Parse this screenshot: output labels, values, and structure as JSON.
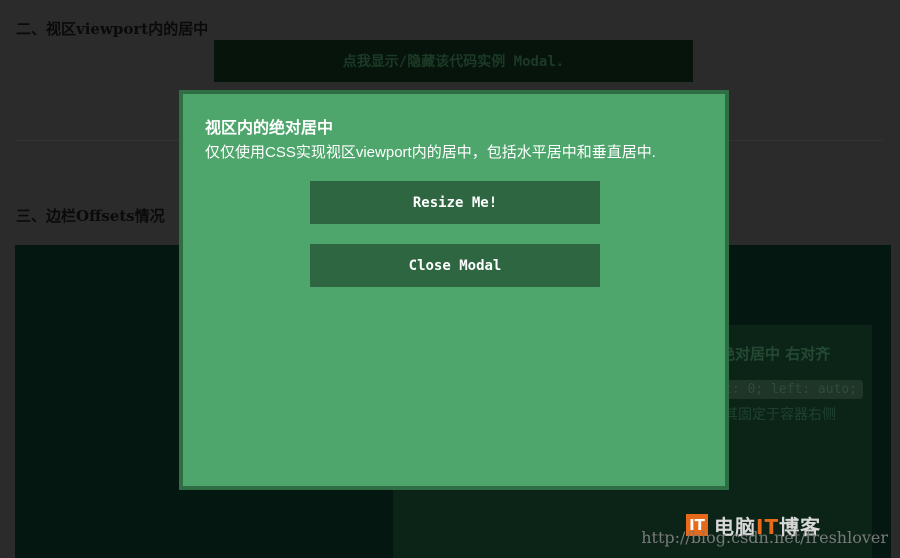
{
  "background": {
    "section2_heading": "二、视区viewport内的居中",
    "demo_button_label": "点我显示/隐藏该代码实例 Modal.",
    "section3_heading": "三、边栏Offsets情况",
    "inner_box": {
      "title": "绝对居中 右对齐",
      "code": "t: 0; left: auto;",
      "text": "其固定于容器右侧"
    }
  },
  "modal": {
    "title": "视区内的绝对居中",
    "description": "仅仅使用CSS实现视区viewport内的居中，包括水平居中和垂直居中.",
    "resize_label": "Resize Me!",
    "close_label": "Close Modal"
  },
  "watermark": {
    "logo_mark": "IT",
    "logo_text_main": "电脑",
    "logo_text_it": "IT",
    "logo_text_tail": "博客",
    "url": "http://blog.csdn.net/freshlover"
  },
  "colors": {
    "page_overlay": "#2b2b2b",
    "modal_bg": "#4ea66c",
    "modal_border": "#2f6e44",
    "modal_button": "#2d6641",
    "logo_accent": "#e66a1a"
  }
}
